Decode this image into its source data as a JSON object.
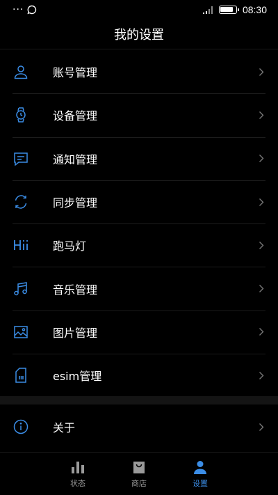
{
  "status_bar": {
    "time": "08:30"
  },
  "header": {
    "title": "我的设置"
  },
  "menu": {
    "items": [
      {
        "label": "账号管理",
        "icon": "user-icon"
      },
      {
        "label": "设备管理",
        "icon": "watch-icon"
      },
      {
        "label": "通知管理",
        "icon": "message-icon"
      },
      {
        "label": "同步管理",
        "icon": "sync-icon"
      },
      {
        "label": "跑马灯",
        "icon": "hi-icon"
      },
      {
        "label": "音乐管理",
        "icon": "music-icon"
      },
      {
        "label": "图片管理",
        "icon": "image-icon"
      },
      {
        "label": "esim管理",
        "icon": "sim-icon"
      }
    ],
    "about": {
      "label": "关于",
      "icon": "info-icon"
    }
  },
  "bottom_nav": {
    "tabs": [
      {
        "label": "状态",
        "icon": "bar-chart-icon"
      },
      {
        "label": "商店",
        "icon": "shopping-bag-icon"
      },
      {
        "label": "设置",
        "icon": "person-icon"
      }
    ],
    "active_index": 2
  },
  "colors": {
    "accent": "#3b8de6",
    "background": "#000000",
    "inactive": "#9a9a9a"
  }
}
